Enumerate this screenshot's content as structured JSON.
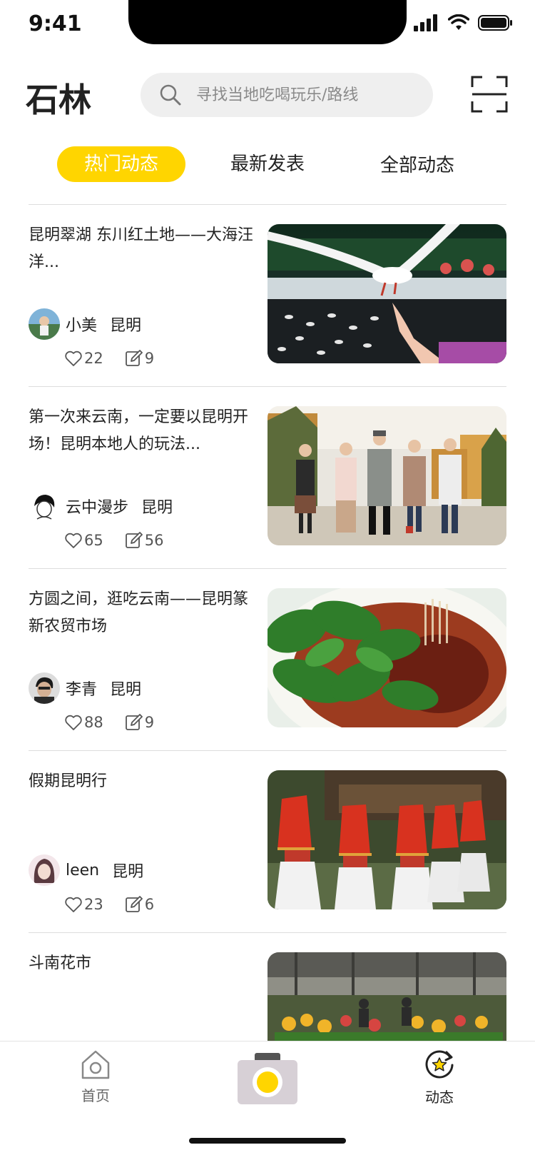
{
  "status_bar": {
    "time": "9:41"
  },
  "header": {
    "title": "石林",
    "search_placeholder": "寻找当地吃喝玩乐/路线",
    "scan_icon": "scan-icon"
  },
  "tabs": [
    {
      "label": "热门动态",
      "active": true
    },
    {
      "label": "最新发表",
      "active": false
    },
    {
      "label": "全部动态",
      "active": false
    }
  ],
  "feed": [
    {
      "title": "昆明翠湖  东川红土地——大海汪洋...",
      "author": "小美",
      "city": "昆明",
      "likes": "22",
      "comments": "9",
      "image": "seagull-photo"
    },
    {
      "title": "第一次来云南，一定要以昆明开场！昆明本地人的玩法...",
      "author": "云中漫步",
      "city": "昆明",
      "likes": "65",
      "comments": "56",
      "image": "group-photo"
    },
    {
      "title": "方圆之间，逛吃云南——昆明篆新农贸市场",
      "author": "李青",
      "city": "昆明",
      "likes": "88",
      "comments": "9",
      "image": "noodle-photo"
    },
    {
      "title": "假期昆明行",
      "author": "leen",
      "city": "昆明",
      "likes": "23",
      "comments": "6",
      "image": "dancers-photo"
    },
    {
      "title": "斗南花市",
      "image": "flower-market-photo"
    }
  ],
  "bottom_nav": {
    "home_label": "首页",
    "dynamic_label": "动态"
  },
  "colors": {
    "accent": "#ffd500",
    "search_bg": "#efefef",
    "divider": "#dddddd"
  }
}
